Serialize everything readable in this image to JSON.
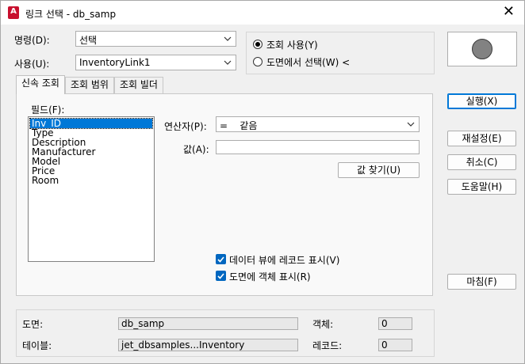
{
  "window": {
    "title": "링크 선택 - db_samp",
    "app_icon_text": "A",
    "close_glyph": "✕"
  },
  "command": {
    "label": "명령(D):",
    "value": "선택"
  },
  "usage": {
    "label": "사용(U):",
    "value": "InventoryLink1"
  },
  "source_options": [
    {
      "label": "조회 사용(Y)",
      "selected": true
    },
    {
      "label": "도면에서 선택(W) <",
      "selected": false
    }
  ],
  "tabs": [
    {
      "label": "신속 조회",
      "active": true
    },
    {
      "label": "조회 범위",
      "active": false
    },
    {
      "label": "조회 빌더",
      "active": false
    }
  ],
  "fields": {
    "label": "필드(F):",
    "items": [
      "Inv_ID",
      "Type",
      "Description",
      "Manufacturer",
      "Model",
      "Price",
      "Room"
    ],
    "selected_index": 0
  },
  "operator": {
    "label": "연산자(P):",
    "value": "=    같음"
  },
  "value_field": {
    "label": "값(A):",
    "value": ""
  },
  "find_values_button": "값 찾기(U)",
  "checkboxes": [
    {
      "label": "데이터 뷰에 레코드 표시(V)",
      "checked": true
    },
    {
      "label": "도면에 객체 표시(R)",
      "checked": true
    }
  ],
  "buttons": {
    "execute": "실행(X)",
    "reset": "재설정(E)",
    "cancel": "취소(C)",
    "help": "도움말(H)",
    "finish": "마침(F)"
  },
  "status": {
    "drawing_label": "도면:",
    "drawing_value": "db_samp",
    "table_label": "테이블:",
    "table_value": "jet_dbsamples...Inventory",
    "objects_label": "객체:",
    "objects_value": "0",
    "records_label": "레코드:",
    "records_value": "0"
  },
  "colors": {
    "selection": "#0078d7",
    "checkbox": "#0067c0",
    "app_icon": "#c8102e",
    "preview_circle": "#828282"
  },
  "icons": {
    "app": "autocad-app-icon",
    "close": "close-icon",
    "dropdown": "chevron-down-icon",
    "preview": "circle-preview-icon",
    "check": "checkmark-icon"
  }
}
